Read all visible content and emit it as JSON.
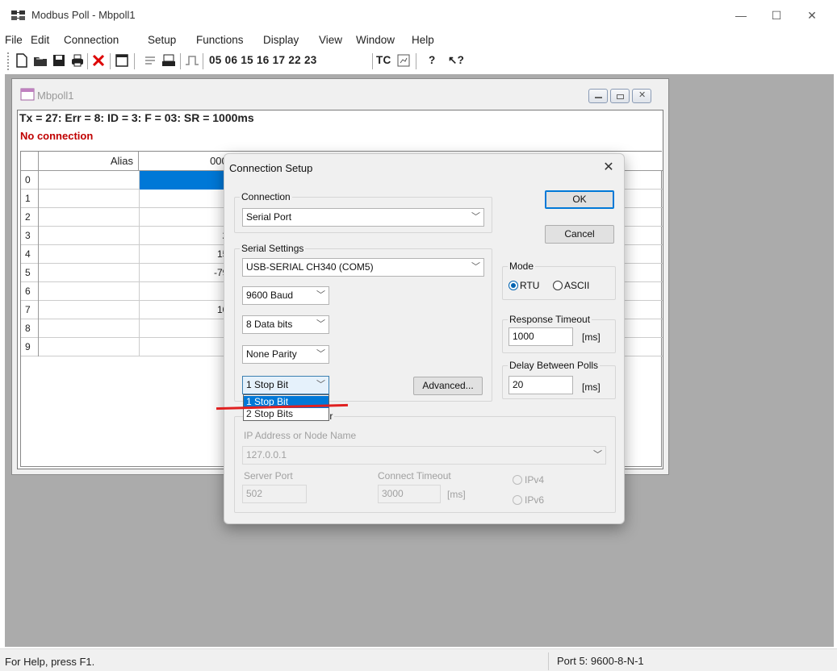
{
  "window": {
    "title": "Modbus Poll - Mbpoll1"
  },
  "menu": [
    "File",
    "Edit",
    "Connection",
    "Setup",
    "Functions",
    "Display",
    "View",
    "Window",
    "Help"
  ],
  "toolbar": {
    "function_codes": "05 06 15 16 17 22 23",
    "tc_label": "TC"
  },
  "child": {
    "title": "Mbpoll1",
    "status": "Tx = 27: Err = 8: ID = 3: F = 03: SR = 1000ms",
    "connection_state": "No connection",
    "grid": {
      "alias_header": "Alias",
      "column_header": "0000",
      "rows": [
        {
          "n": "0",
          "v": ""
        },
        {
          "n": "1",
          "v": ""
        },
        {
          "n": "2",
          "v": ""
        },
        {
          "n": "3",
          "v": "24"
        },
        {
          "n": "4",
          "v": "152"
        },
        {
          "n": "5",
          "v": "-793"
        },
        {
          "n": "6",
          "v": ""
        },
        {
          "n": "7",
          "v": "101"
        },
        {
          "n": "8",
          "v": ""
        },
        {
          "n": "9",
          "v": ""
        }
      ]
    }
  },
  "dialog": {
    "title": "Connection Setup",
    "close": "✕",
    "connection_group": "Connection",
    "connection_value": "Serial Port",
    "serial_group": "Serial Settings",
    "port": "USB-SERIAL CH340 (COM5)",
    "baud": "9600 Baud",
    "data_bits": "8 Data bits",
    "parity": "None Parity",
    "stop_bits": "1 Stop Bit",
    "stop_options": [
      "1 Stop Bit",
      "2 Stop Bits"
    ],
    "advanced": "Advanced...",
    "ok": "OK",
    "cancel": "Cancel",
    "mode_group": "Mode",
    "mode_rtu": "RTU",
    "mode_ascii": "ASCII",
    "response_group": "Response Timeout",
    "response_value": "1000",
    "delay_group": "Delay Between Polls",
    "delay_value": "20",
    "unit_ms": "[ms]",
    "tcp_group_tail": "erver",
    "ip_label": "IP Address or Node Name",
    "ip_value": "127.0.0.1",
    "server_port_label": "Server Port",
    "server_port_value": "502",
    "connect_timeout_label": "Connect Timeout",
    "connect_timeout_value": "3000",
    "ipv4": "IPv4",
    "ipv6": "IPv6"
  },
  "statusbar": {
    "help": "For Help, press F1.",
    "port": "Port 5: 9600-8-N-1"
  }
}
